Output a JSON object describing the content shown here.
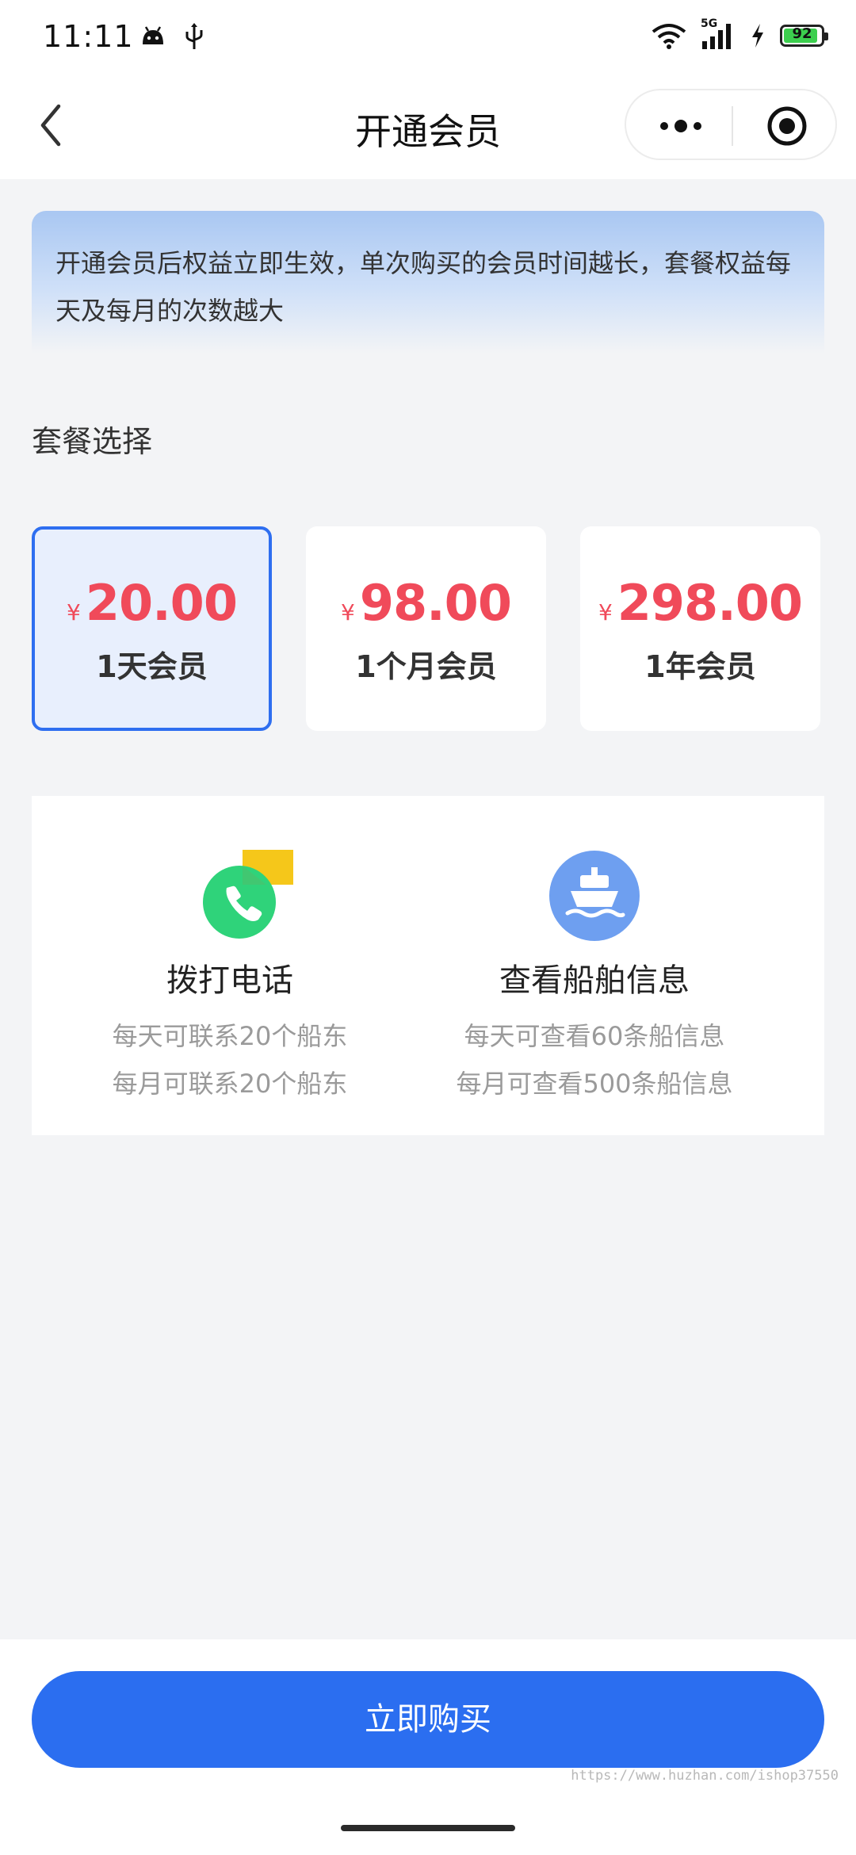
{
  "status_bar": {
    "time": "11:11",
    "signal_label": "5G",
    "battery": 92,
    "battery_text": "92",
    "icons": [
      "android-icon",
      "usb-icon",
      "wifi-icon",
      "cellular-signal-icon",
      "charging-icon",
      "battery-icon"
    ]
  },
  "nav": {
    "title": "开通会员",
    "icons": [
      "back-chevron-icon",
      "more-dots-icon",
      "close-circle-icon"
    ]
  },
  "notice": {
    "text": "开通会员后权益立即生效，单次购买的会员时间越长，套餐权益每天及每月的次数越大"
  },
  "plans": {
    "section_title": "套餐选择",
    "currency": "¥",
    "selected_index": 0,
    "items": [
      {
        "price": "20.00",
        "name": "1天会员"
      },
      {
        "price": "98.00",
        "name": "1个月会员"
      },
      {
        "price": "298.00",
        "name": "1年会员"
      }
    ]
  },
  "benefits": [
    {
      "icon": "phone-call-icon",
      "title": "拨打电话",
      "line1": "每天可联系20个船东",
      "line2": "每月可联系20个船东"
    },
    {
      "icon": "ship-icon",
      "title": "查看船舶信息",
      "line1": "每天可查看60条船信息",
      "line2": "每月可查看500条船信息"
    }
  ],
  "bottom": {
    "buy_label": "立即购买",
    "watermark": "https://www.huzhan.com/ishop37550"
  },
  "colors": {
    "accent": "#2b6ef0",
    "price": "#f04a5a",
    "selected_bg": "#e8effd",
    "phone_green": "#2fd37a",
    "ship_blue": "#6e9ff0",
    "chat_yellow": "#f5c71a"
  }
}
